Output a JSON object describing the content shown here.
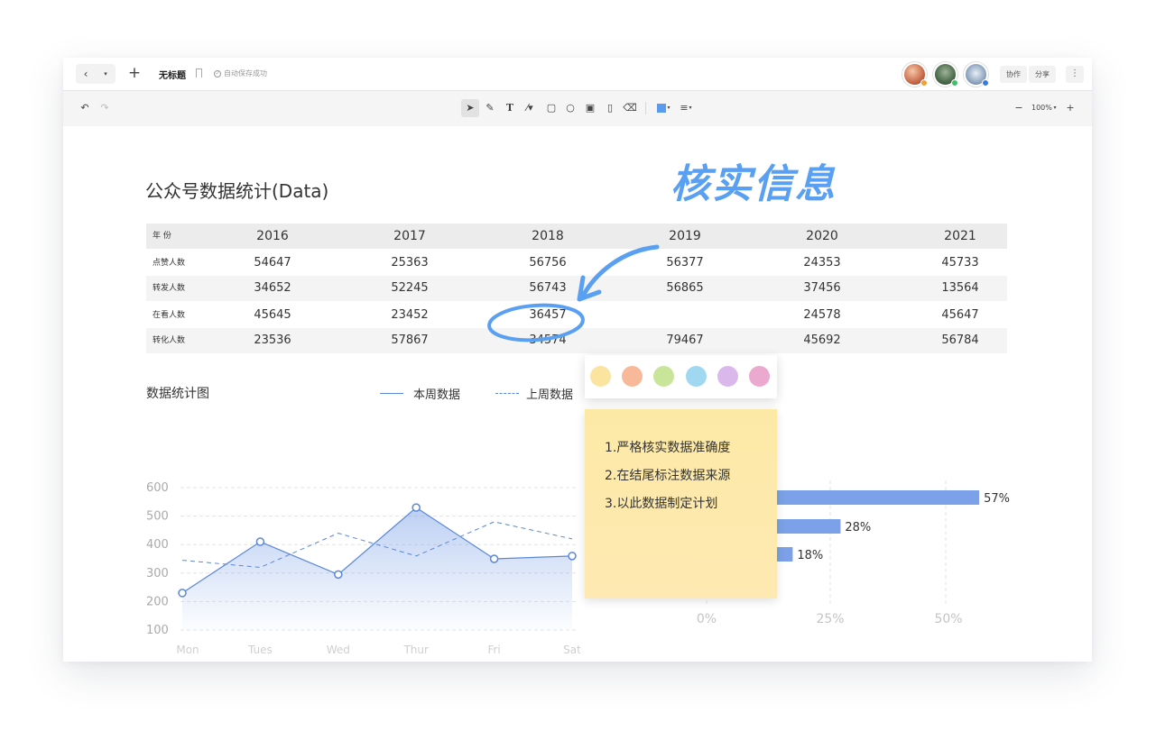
{
  "topbar": {
    "title": "无标题",
    "saved_status": "自动保存成功",
    "collab_label": "协作",
    "share_label": "分享",
    "more_label": "⋮"
  },
  "toolbar": {
    "zoom": "100%",
    "fill_color": "#5b9bef"
  },
  "canvas": {
    "page_title": "公众号数据统计(Data)",
    "annotation": "核实信息",
    "table": {
      "header_label": "年 份",
      "years": [
        "2016",
        "2017",
        "2018",
        "2019",
        "2020",
        "2021"
      ],
      "rows": [
        {
          "label": "点赞人数",
          "values": [
            "54647",
            "25363",
            "56756",
            "56377",
            "24353",
            "45733"
          ]
        },
        {
          "label": "转发人数",
          "values": [
            "34652",
            "52245",
            "56743",
            "56865",
            "37456",
            "13564"
          ]
        },
        {
          "label": "在看人数",
          "values": [
            "45645",
            "23452",
            "36457",
            "",
            "24578",
            "45647"
          ]
        },
        {
          "label": "转化人数",
          "values": [
            "23536",
            "57867",
            "34574",
            "79467",
            "45692",
            "56784"
          ]
        }
      ]
    },
    "chart_title": "数据统计图",
    "legend_current": "本周数据",
    "legend_previous": "上周数据",
    "palette": [
      "#fbe3a0",
      "#f7b99a",
      "#c8e59a",
      "#9fd8f0",
      "#dbb8ec",
      "#eba9cf"
    ],
    "sticky_note": [
      "1.严格核实数据准确度",
      "2.在结尾标注数据来源",
      "3.以此数据制定计划"
    ]
  },
  "chart_data": [
    {
      "type": "line",
      "x": [
        "Mon",
        "Tues",
        "Wed",
        "Thur",
        "Fri",
        "Sat"
      ],
      "ylim": [
        100,
        600
      ],
      "yticks": [
        100,
        200,
        300,
        400,
        500,
        600
      ],
      "series": [
        {
          "name": "本周数据",
          "values": [
            230,
            410,
            295,
            530,
            350,
            360
          ]
        },
        {
          "name": "上周数据",
          "values": [
            345,
            320,
            440,
            360,
            480,
            420
          ]
        }
      ],
      "grid": true
    },
    {
      "type": "bar",
      "orientation": "horizontal",
      "values": [
        57,
        28,
        18
      ],
      "value_labels": [
        "57%",
        "28%",
        "18%"
      ],
      "xticks": [
        "0%",
        "25%",
        "50%"
      ],
      "xlim": [
        0,
        57
      ],
      "color": "#6e97e6"
    }
  ]
}
